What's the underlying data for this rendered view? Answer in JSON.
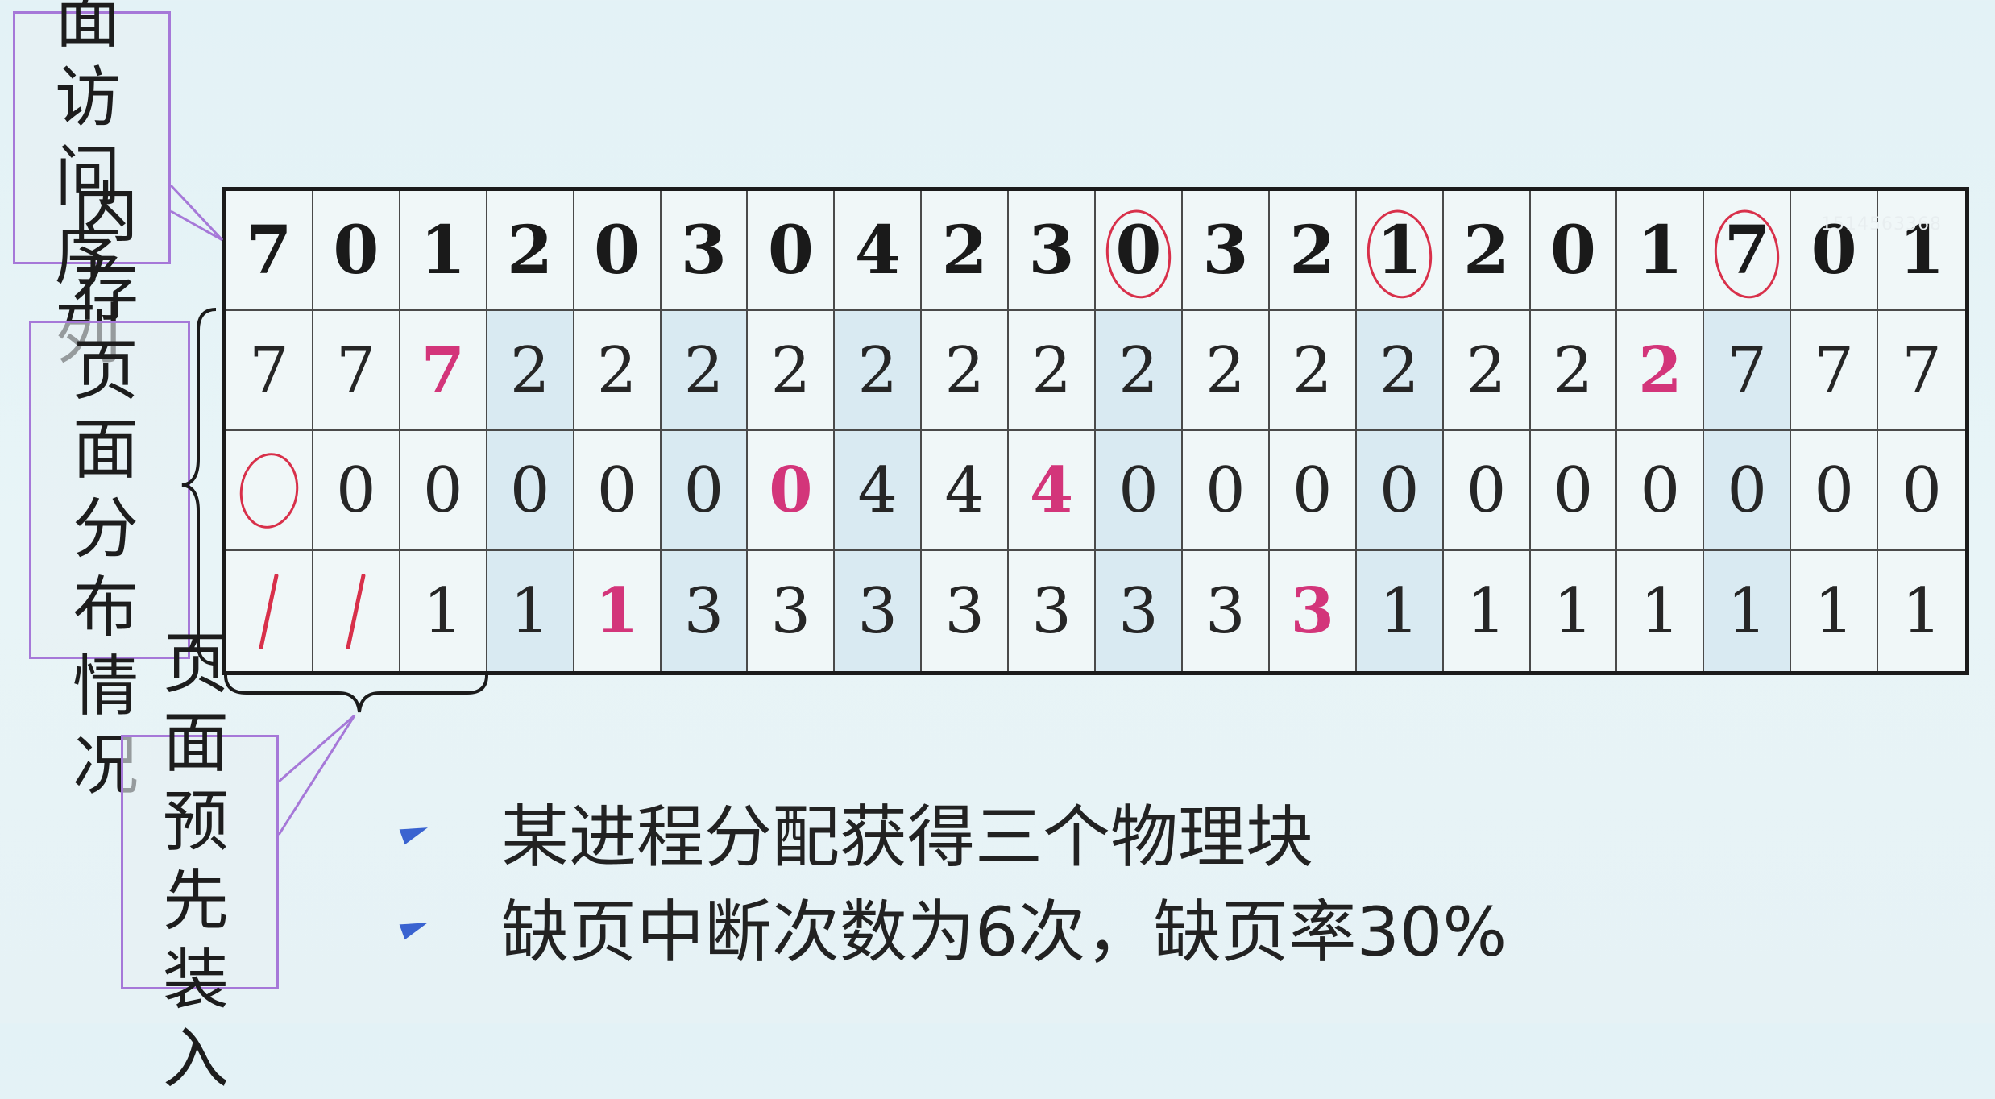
{
  "labels": {
    "sequence": "页面访问序列",
    "memory": "内存页面分布情况",
    "preload": "页面预先装入"
  },
  "watermark": "1514563368",
  "access_sequence": [
    "7",
    "0",
    "1",
    "2",
    "0",
    "3",
    "0",
    "4",
    "2",
    "3",
    "0",
    "3",
    "2",
    "1",
    "2",
    "0",
    "1",
    "7",
    "0",
    "1"
  ],
  "frames": [
    [
      "7",
      "7",
      "7",
      "2",
      "2",
      "2",
      "2",
      "2",
      "2",
      "2",
      "2",
      "2",
      "2",
      "2",
      "2",
      "2",
      "2",
      "7",
      "7",
      "7"
    ],
    [
      "◯",
      "0",
      "0",
      "0",
      "0",
      "0",
      "0",
      "4",
      "4",
      "4",
      "0",
      "0",
      "0",
      "0",
      "0",
      "0",
      "0",
      "0",
      "0",
      "0"
    ],
    [
      "/",
      "/",
      "1",
      "1",
      "1",
      "3",
      "3",
      "3",
      "3",
      "3",
      "3",
      "3",
      "3",
      "1",
      "1",
      "1",
      "1",
      "1",
      "1",
      "1"
    ]
  ],
  "circled_columns": [
    10,
    13,
    17
  ],
  "fault_columns": [
    3,
    5,
    7,
    10,
    13,
    17
  ],
  "highlights": [
    [
      0,
      2
    ],
    [
      1,
      6
    ],
    [
      1,
      9
    ],
    [
      2,
      4
    ],
    [
      2,
      12
    ],
    [
      0,
      16
    ]
  ],
  "bullets": [
    "某进程分配获得三个物理块",
    "缺页中断次数为6次，缺页率30%"
  ],
  "colors": {
    "highlight": "#d3357a",
    "annotation": "#d8304a",
    "label_border": "#a678d8",
    "bullet": "#3a63d0"
  }
}
